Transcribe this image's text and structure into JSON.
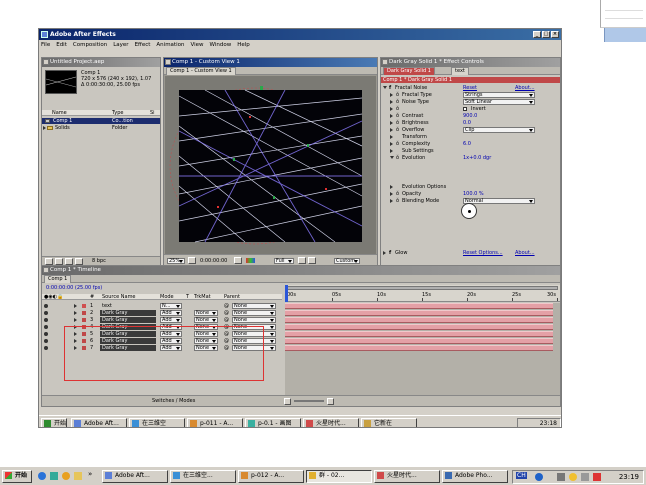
{
  "app": {
    "title": "Adobe After Effects",
    "menu": [
      "File",
      "Edit",
      "Composition",
      "Layer",
      "Effect",
      "Animation",
      "View",
      "Window",
      "Help"
    ]
  },
  "project": {
    "title": "Untitled Project.aep",
    "comp_name": "Comp 1",
    "comp_info_1": "720 x 576 (240 x 192), 1.07",
    "comp_info_2": "Δ 0:00:30:00, 25.00 fps",
    "col_name": "Name",
    "col_type": "Type",
    "col_size": "Si",
    "items": [
      {
        "name": "Comp 1",
        "type": "Co...tion",
        "selected": true
      },
      {
        "name": "Solids",
        "type": "Folder",
        "selected": false
      }
    ],
    "bpc": "8 bpc"
  },
  "comp_view": {
    "title": "Comp 1 - Custom View 1",
    "tab": "Comp 1 - Custom View 1",
    "zoom": "25%",
    "timecode": "0:00:00:00",
    "resolution": "Full",
    "view": "Custom"
  },
  "effect_controls": {
    "title": "Dark Gray Solid 1 * Effect Controls",
    "tab1": "Dark Gray Solid 1",
    "tab2": "text",
    "breadcrumb": "Comp 1 * Dark Gray Solid 1",
    "effect_name": "Fractal Noise",
    "reset": "Reset",
    "about": "About...",
    "props": [
      {
        "label": "Fractal Type",
        "value": "Strings",
        "kind": "dropdown"
      },
      {
        "label": "Noise Type",
        "value": "Soft Linear",
        "kind": "dropdown"
      },
      {
        "label": "",
        "value": "Invert",
        "kind": "check"
      },
      {
        "label": "Contrast",
        "value": "900.0",
        "kind": "num"
      },
      {
        "label": "Brightness",
        "value": "0.0",
        "kind": "num"
      },
      {
        "label": "Overflow",
        "value": "Clip",
        "kind": "dropdown"
      },
      {
        "label": "Transform",
        "value": "",
        "kind": "group"
      },
      {
        "label": "Complexity",
        "value": "6.0",
        "kind": "num"
      },
      {
        "label": "Sub Settings",
        "value": "",
        "kind": "group"
      },
      {
        "label": "Evolution",
        "value": "1x+0.0 dgr",
        "kind": "num"
      },
      {
        "label": "Evolution Options",
        "value": "",
        "kind": "group"
      },
      {
        "label": "Opacity",
        "value": "100.0 %",
        "kind": "num"
      },
      {
        "label": "Blending Mode",
        "value": "Normal",
        "kind": "dropdown"
      }
    ],
    "glow_name": "Glow",
    "glow_reset": "Reset Options...",
    "glow_about": "About..."
  },
  "timeline": {
    "title": "Comp 1 * Timeline",
    "tab": "Comp 1",
    "timecode": "0:00:00:00 (25.00 fps)",
    "headers": {
      "num": "#",
      "source": "Source Name",
      "mode": "Mode",
      "t": "T",
      "trkmat": "TrkMat",
      "parent": "Parent"
    },
    "ruler": [
      "00s",
      "05s",
      "10s",
      "15s",
      "20s",
      "25s",
      "30s"
    ],
    "layers": [
      {
        "num": "1",
        "name": "text",
        "mode": "N...",
        "trkmat": "",
        "parent": "None"
      },
      {
        "num": "2",
        "name": "Dark Gray",
        "mode": "Add",
        "trkmat": "None",
        "parent": "None"
      },
      {
        "num": "3",
        "name": "Dark Gray",
        "mode": "Add",
        "trkmat": "None",
        "parent": "None"
      },
      {
        "num": "4",
        "name": "Dark Gray",
        "mode": "Add",
        "trkmat": "None",
        "parent": "None"
      },
      {
        "num": "5",
        "name": "Dark Gray",
        "mode": "Add",
        "trkmat": "None",
        "parent": "None"
      },
      {
        "num": "6",
        "name": "Dark Gray",
        "mode": "Add",
        "trkmat": "None",
        "parent": "None"
      },
      {
        "num": "7",
        "name": "Dark Gray",
        "mode": "Add",
        "trkmat": "None",
        "parent": "None"
      }
    ],
    "switches": "Switches / Modes"
  },
  "inner_taskbar": {
    "start": "开始",
    "items": [
      "Adobe Aft...",
      "在三维空",
      "p-011 - A...",
      "p-0.1 - 画图",
      "火星时代...",
      "它新在"
    ],
    "clock": "23:18"
  },
  "taskbar": {
    "start": "开始",
    "items": [
      "Adobe Aft...",
      "在三维空...",
      "p-012 - A...",
      "群 - 02...",
      "火星时代...",
      "Adobe Pho..."
    ],
    "ime": "CH",
    "clock": "23:19"
  }
}
